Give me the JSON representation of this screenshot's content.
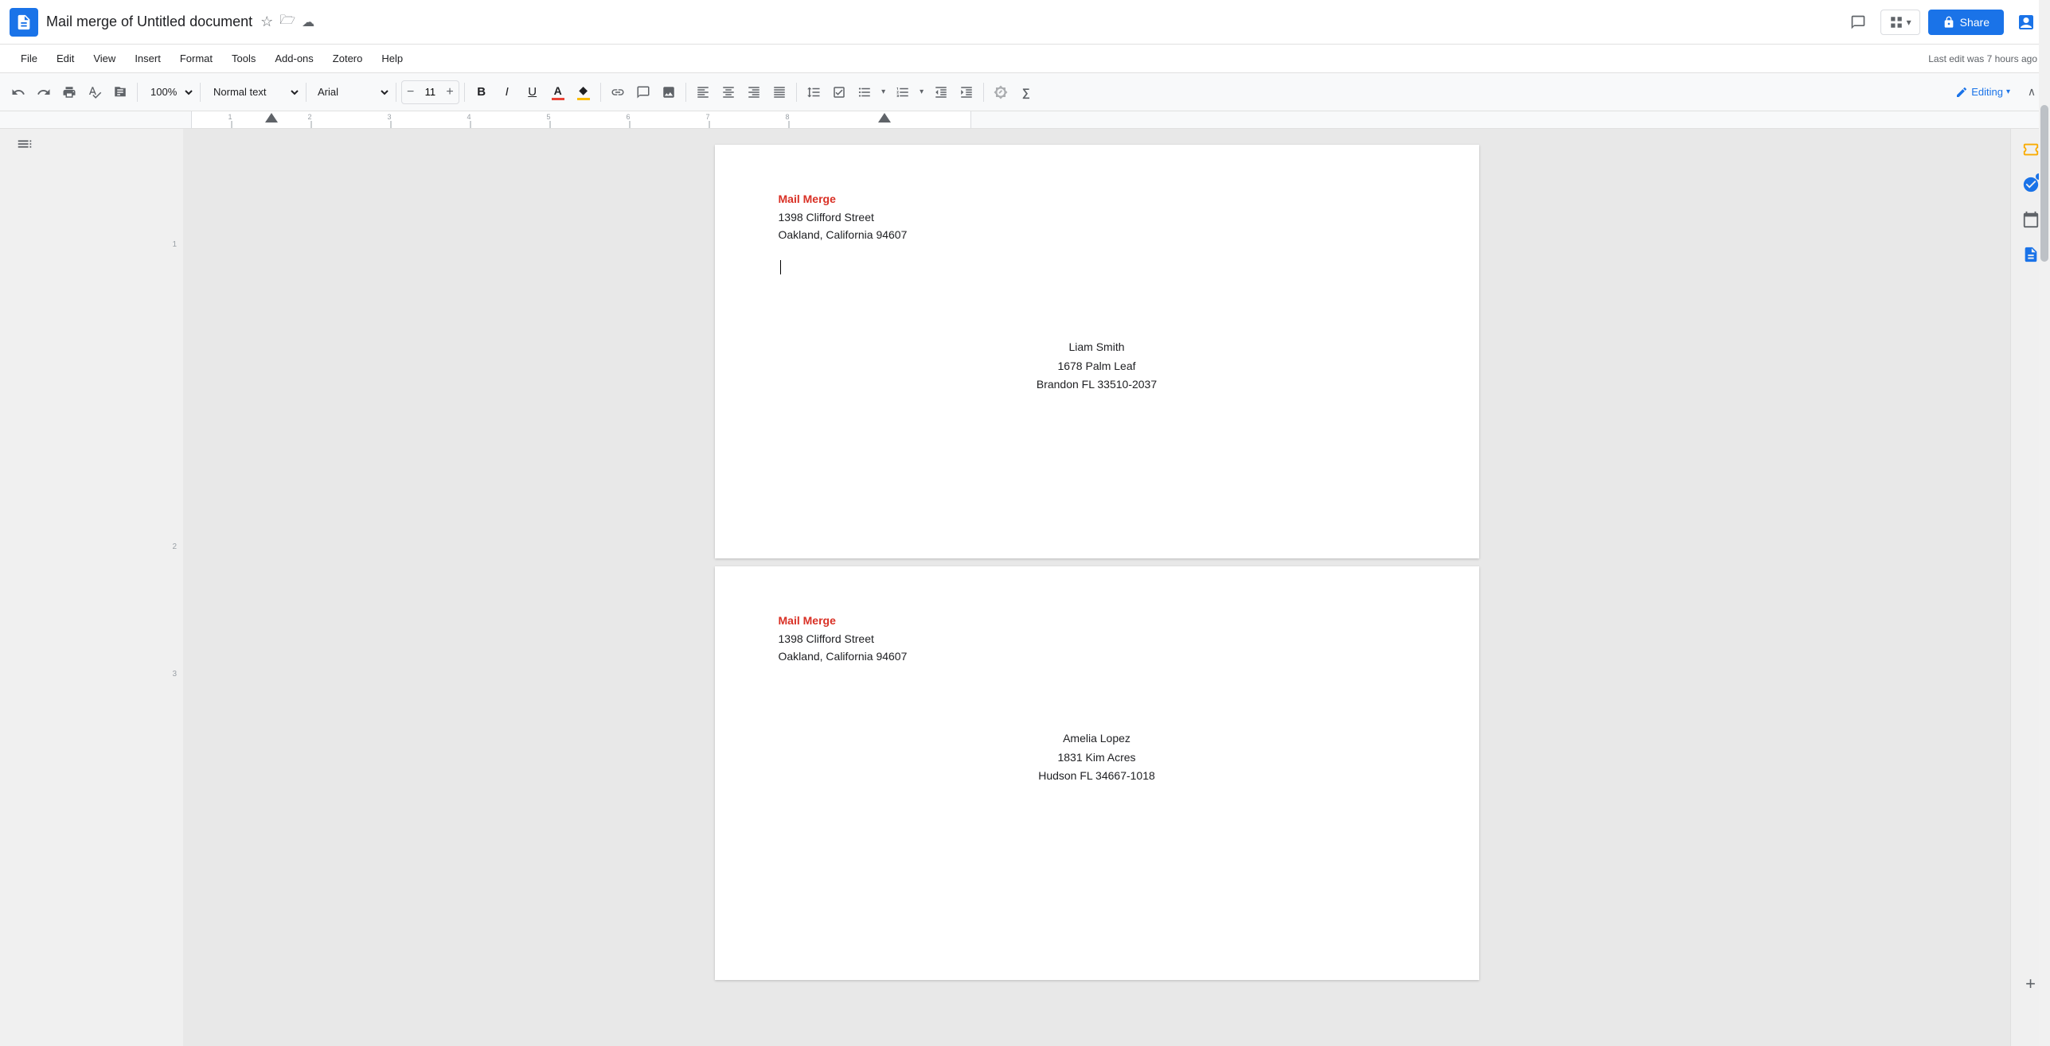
{
  "app": {
    "logo_alt": "Google Docs",
    "doc_title": "Mail merge of Untitled document",
    "title_icon_star": "☆",
    "title_icon_folder": "🗁",
    "title_icon_cloud": "☁"
  },
  "header_right": {
    "comment_icon": "💬",
    "version_icon": "⊞",
    "version_dropdown": "▾",
    "share_icon": "🔒",
    "share_label": "Share",
    "multiuser_icon": "👤"
  },
  "menubar": {
    "items": [
      "File",
      "Edit",
      "View",
      "Insert",
      "Format",
      "Tools",
      "Add-ons",
      "Zotero",
      "Help"
    ],
    "last_edit": "Last edit was 7 hours ago"
  },
  "toolbar": {
    "undo": "↩",
    "redo": "↪",
    "print": "🖨",
    "paint_format": "✎",
    "copy_format": "📋",
    "zoom_value": "100%",
    "style_label": "Normal text",
    "font_name": "Arial",
    "font_size": "11",
    "decrease_font": "−",
    "increase_font": "+",
    "bold": "B",
    "italic": "I",
    "underline": "U",
    "text_color": "A",
    "highlight": "◆",
    "link": "🔗",
    "comment": "💬",
    "image": "🖼",
    "align_left": "≡",
    "align_center": "≡",
    "align_right": "≡",
    "align_justify": "≡",
    "line_spacing": "↕",
    "checklist": "☑",
    "bullets": "≡",
    "bullets_dropdown": "▾",
    "numbered": "≡",
    "numbered_dropdown": "▾",
    "indent_decrease": "←",
    "indent_increase": "→",
    "clear_format": "✗",
    "equation": "Ω",
    "editing_pen": "✏",
    "editing_label": "Editing",
    "editing_dropdown": "▾",
    "collapse": "∧"
  },
  "left_panel": {
    "outline_icon": "☰"
  },
  "right_panel": {
    "icons": [
      {
        "name": "keep-icon",
        "glyph": "📌",
        "active": false
      },
      {
        "name": "tasks-icon",
        "glyph": "✓",
        "active": true,
        "badge": true
      },
      {
        "name": "calendar-icon",
        "glyph": "📅",
        "active": false
      },
      {
        "name": "docs-icon",
        "glyph": "📄",
        "active": false
      }
    ],
    "add_icon": "+"
  },
  "page1": {
    "sender_name": "Mail Merge",
    "sender_address_line1": "1398 Clifford Street",
    "sender_address_line2": "Oakland, California 94607",
    "recipient_name": "Liam Smith",
    "recipient_address_line1": "1678 Palm Leaf",
    "recipient_address_line2": "Brandon FL 33510-2037"
  },
  "page2": {
    "sender_name": "Mail Merge",
    "sender_address_line1": "1398 Clifford Street",
    "sender_address_line2": "Oakland, California 94607",
    "recipient_name": "Amelia Lopez",
    "recipient_address_line1": "1831 Kim Acres",
    "recipient_address_line2": "Hudson FL 34667-1018"
  },
  "page_numbers": {
    "p1": "1",
    "p2": "2",
    "p3": "3"
  }
}
